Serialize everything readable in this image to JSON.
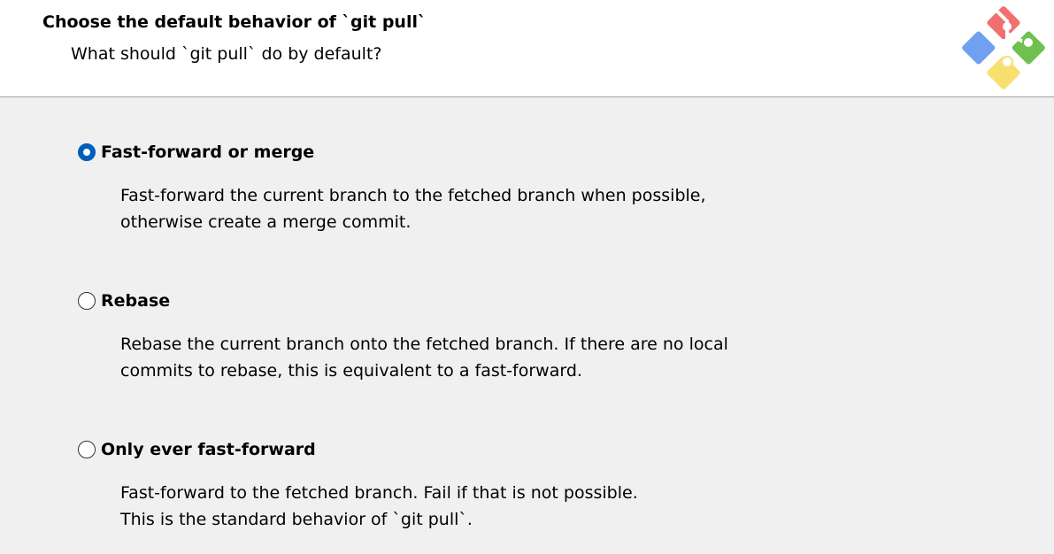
{
  "header": {
    "title": "Choose the default behavior of `git pull`",
    "subtitle": "What should `git pull` do by default?",
    "logo_icon": "git-logo-icon"
  },
  "options": [
    {
      "label": "Fast-forward or merge",
      "checked": true,
      "description_line1": "Fast-forward the current branch to the fetched branch when possible,",
      "description_line2": "otherwise create a merge commit."
    },
    {
      "label": "Rebase",
      "checked": false,
      "description_line1": "Rebase the current branch onto the fetched branch. If there are no local",
      "description_line2": "commits to rebase, this is equivalent to a fast-forward."
    },
    {
      "label": "Only ever fast-forward",
      "checked": false,
      "description_line1": "Fast-forward to the fetched branch. Fail if that is not possible.",
      "description_line2": "This is the standard behavior of `git pull`."
    }
  ],
  "colors": {
    "header_bg": "#ffffff",
    "body_bg": "#f0f0f0",
    "radio_selected": "#005fb8",
    "logo_red": "#f07070",
    "logo_blue": "#70a0f0",
    "logo_green": "#70c050",
    "logo_yellow": "#f8e070"
  }
}
